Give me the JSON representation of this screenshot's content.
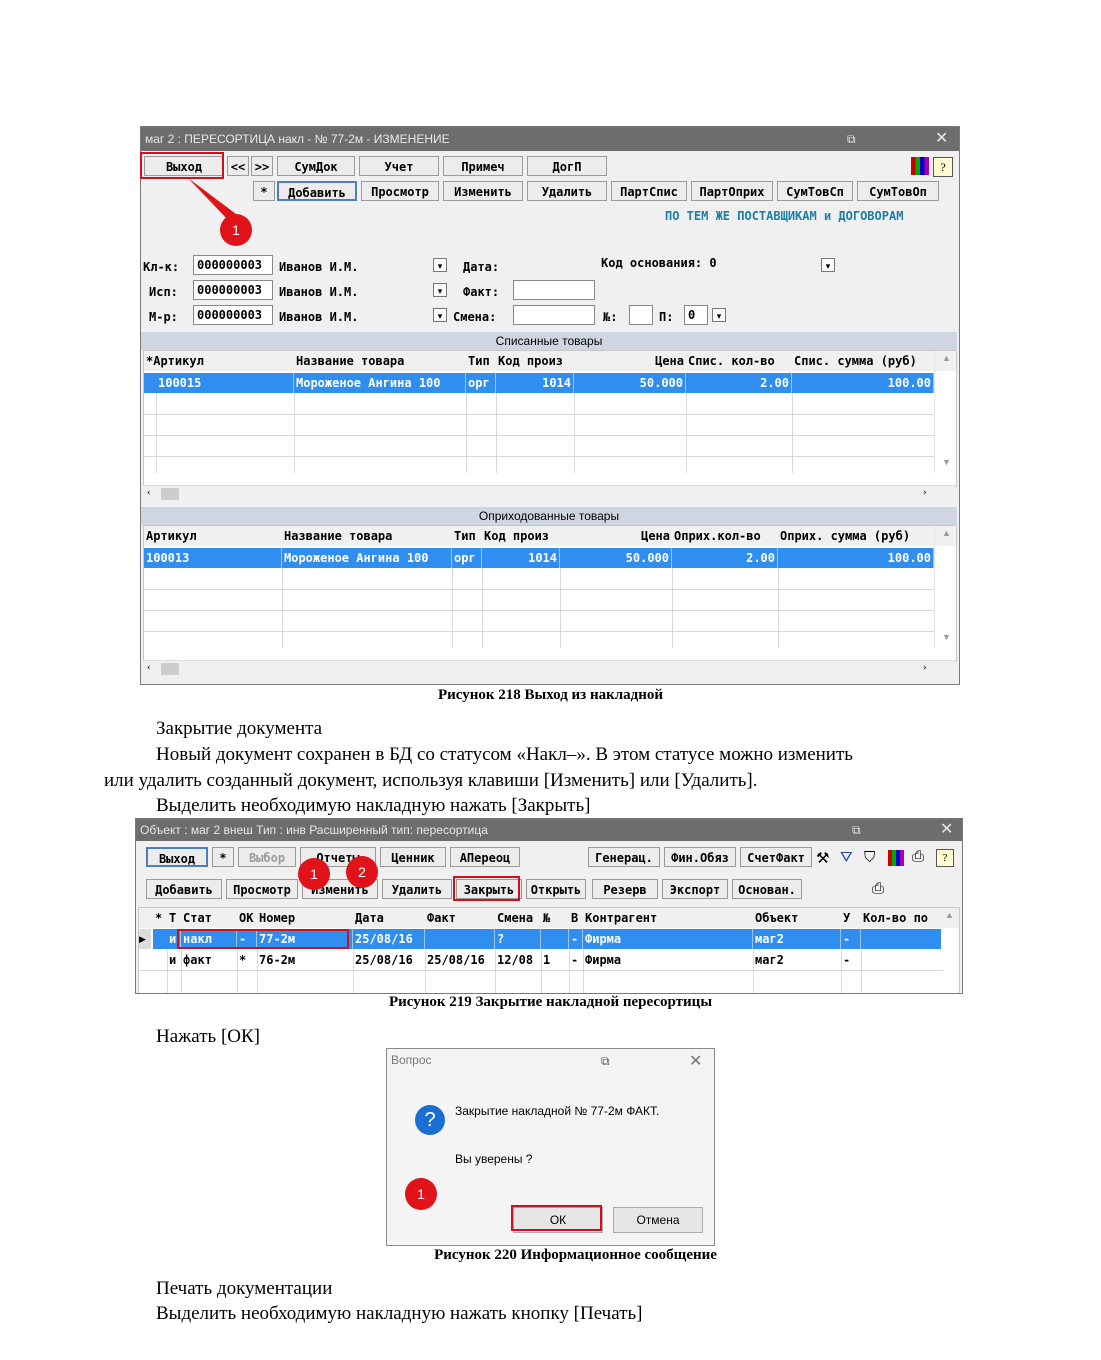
{
  "fig1": {
    "title": "маг   2 : ПЕРЕСОРТИЦА накл - № 77-2м  - ИЗМЕНЕНИЕ",
    "toolbar1": [
      "Выход",
      "<<",
      ">>",
      "СумДок",
      "Учет",
      "Примеч",
      "ДогП"
    ],
    "toolbar2": [
      "*",
      "Добавить",
      "Просмотр",
      "Изменить",
      "Удалить",
      "ПартСпис",
      "ПартОприх",
      "СумТовСп",
      "СумТовОп"
    ],
    "banner": "ПО ТЕМ ЖЕ ПОСТАВЩИКАМ и ДОГОВОРАМ",
    "form": {
      "klk_label": "Кл-к:",
      "klk_code": "000000003",
      "klk_name": "Иванов И.М.",
      "isp_label": "Исп:",
      "isp_code": "000000003",
      "isp_name": "Иванов И.М.",
      "mr_label": "М-р:",
      "mr_code": "000000003",
      "mr_name": "Иванов И.М.",
      "date_label": "Дата:",
      "fact_label": "Факт:",
      "smena_label": "Смена:",
      "kod_label": "Код основания: 0",
      "n_label": "№:",
      "p_label": "П:",
      "p_value": "0"
    },
    "written_off": {
      "section": "Списанные товары",
      "headers": [
        "Артикул",
        "Название товара",
        "Тип",
        "Код произ",
        "Цена",
        "Спис. кол-во",
        "Спис. сумма (руб)"
      ],
      "row": [
        "100015",
        "Мороженое Ангина 100",
        "орг",
        "1014",
        "50.000",
        "2.00",
        "100.00"
      ]
    },
    "received": {
      "section": "Оприходованные товары",
      "headers": [
        "Артикул",
        "Название товара",
        "Тип",
        "Код произ",
        "Цена",
        "Оприх.кол-во",
        "Оприх. сумма (руб)"
      ],
      "row": [
        "100013",
        "Мороженое Ангина 100",
        "орг",
        "1014",
        "50.000",
        "2.00",
        "100.00"
      ]
    },
    "callout": "1"
  },
  "caption1": "Рисунок 218 Выход из накладной",
  "text1": {
    "line1": "Закрытие документа",
    "line2": "Новый документ сохранен в БД со статусом «Накл–». В этом статусе можно изменить",
    "line3": "или удалить созданный документ, используя клавиши [Изменить] или [Удалить].",
    "line4": "Выделить необходимую накладную нажать [Закрыть]"
  },
  "fig2": {
    "title": "Объект : маг 2  внеш   Тип : инв Расширенный тип: пересортица",
    "toolbar1": [
      "Выход",
      "*",
      "Выбор",
      "Отчеты",
      "Ценник",
      "АПереоц",
      "Генерац.",
      "Фин.Обяз",
      "СчетФакт"
    ],
    "toolbar2": [
      "Добавить",
      "Просмотр",
      "Изменить",
      "Удалить",
      "Закрыть",
      "Открыть",
      "Резерв",
      "Экспорт",
      "Основан."
    ],
    "headers": [
      "*",
      "Т",
      "Стат",
      "ОК",
      "Номер",
      "Дата",
      "Факт",
      "Смена",
      "№",
      "В",
      "Контрагент",
      "Объект",
      "У",
      "Кол-во по"
    ],
    "rows": [
      [
        "",
        "и",
        "накл",
        "-",
        "77-2м",
        "25/08/16",
        "",
        "?",
        "",
        "-",
        "Фирма",
        "маг2",
        "-",
        ""
      ],
      [
        "",
        "и",
        "факт",
        "*",
        "76-2м",
        "25/08/16",
        "25/08/16",
        "12/08",
        "1",
        "-",
        "Фирма",
        "маг2",
        "-",
        ""
      ]
    ],
    "callout1": "1",
    "callout2": "2"
  },
  "caption2": "Рисунок 219 Закрытие накладной пересортицы",
  "text2": "Нажать [ОК]",
  "dialog": {
    "title": "Вопрос",
    "message": "Закрытие накладной №  77-2м ФАКТ.",
    "question": "Вы уверены ?",
    "ok": "ОК",
    "cancel": "Отмена",
    "callout": "1"
  },
  "caption3": "Рисунок 220 Информационное сообщение",
  "text3": {
    "line1": "Печать документации",
    "line2": "Выделить необходимую накладную нажать кнопку [Печать]"
  },
  "colors": {
    "selection": "#2f8ef0",
    "annotation": "#e0121a",
    "titlebar": "#6d6d6d",
    "banner": "#1a7fa8"
  }
}
